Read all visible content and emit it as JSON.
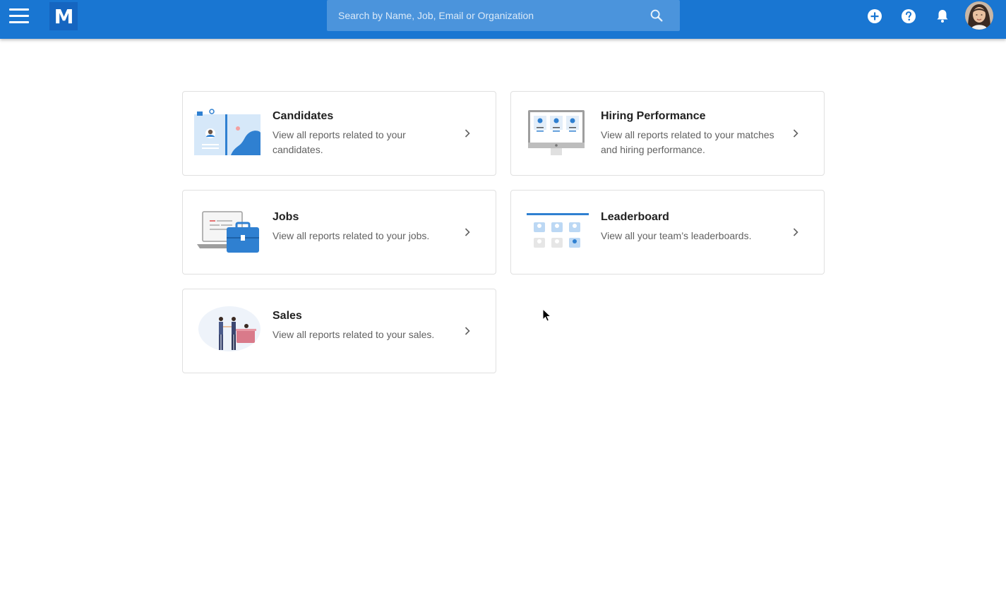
{
  "app": {
    "logo_letter": "M"
  },
  "search": {
    "placeholder": "Search by Name, Job, Email or Organization"
  },
  "topbar_icons": [
    "add-circle-icon",
    "help-icon",
    "bell-icon",
    "avatar"
  ],
  "colors": {
    "brand": "#1976d2",
    "accent": "#2f80d1"
  },
  "cards": [
    {
      "title": "Candidates",
      "description": "View all reports related to your candidates."
    },
    {
      "title": "Hiring Performance",
      "description": "View all reports related to your matches and hiring performance."
    },
    {
      "title": "Jobs",
      "description": "View all reports related to your jobs."
    },
    {
      "title": "Leaderboard",
      "description": "View all your team’s leaderboards."
    },
    {
      "title": "Sales",
      "description": "View all reports related to your sales."
    }
  ]
}
